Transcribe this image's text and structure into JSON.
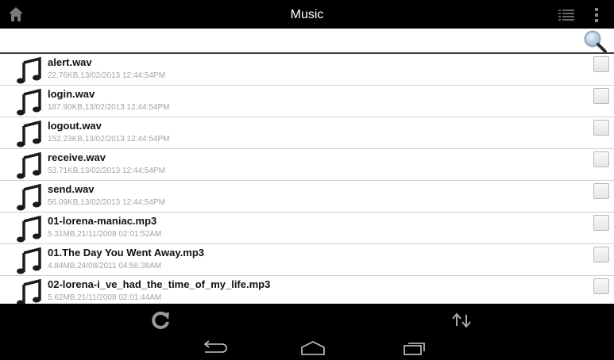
{
  "titlebar": {
    "title": "Music",
    "home_icon": "home-icon",
    "list_icon": "list-view-icon",
    "menu_icon": "overflow-menu-icon"
  },
  "search": {
    "value": "",
    "placeholder": "",
    "icon": "magnifier-icon"
  },
  "files": [
    {
      "name": "alert.wav",
      "meta": "22.76KB,13/02/2013 12:44:54PM",
      "icon": "music-note-icon",
      "checked": false
    },
    {
      "name": "login.wav",
      "meta": "187.90KB,13/02/2013 12:44:54PM",
      "icon": "music-note-icon",
      "checked": false
    },
    {
      "name": "logout.wav",
      "meta": "152.23KB,13/02/2013 12:44:54PM",
      "icon": "music-note-icon",
      "checked": false
    },
    {
      "name": "receive.wav",
      "meta": "53.71KB,13/02/2013 12:44:54PM",
      "icon": "music-note-icon",
      "checked": false
    },
    {
      "name": "send.wav",
      "meta": "56.09KB,13/02/2013 12:44:54PM",
      "icon": "music-note-icon",
      "checked": false
    },
    {
      "name": "01-lorena-maniac.mp3",
      "meta": "5.31MB,21/11/2008 02:01:52AM",
      "icon": "music-note-icon",
      "checked": false
    },
    {
      "name": "01.The Day You Went Away.mp3",
      "meta": "4.84MB,24/08/2011 04:56:38AM",
      "icon": "music-note-icon",
      "checked": false
    },
    {
      "name": "02-lorena-i_ve_had_the_time_of_my_life.mp3",
      "meta": "5.62MB,21/11/2008 02:01:44AM",
      "icon": "music-note-icon",
      "checked": false
    }
  ],
  "actionbar": {
    "refresh_icon": "refresh-icon",
    "sort_icon": "sort-icon"
  },
  "navbar": {
    "back_icon": "back-icon",
    "home_icon": "home-outline-icon",
    "recents_icon": "recent-apps-icon"
  },
  "colors": {
    "bar_background": "#000000",
    "title_text": "#ffffff",
    "file_name": "#111111",
    "file_meta": "#a4a4a4",
    "divider": "#d0d0d0",
    "icon_gray": "#8a8a8a"
  }
}
